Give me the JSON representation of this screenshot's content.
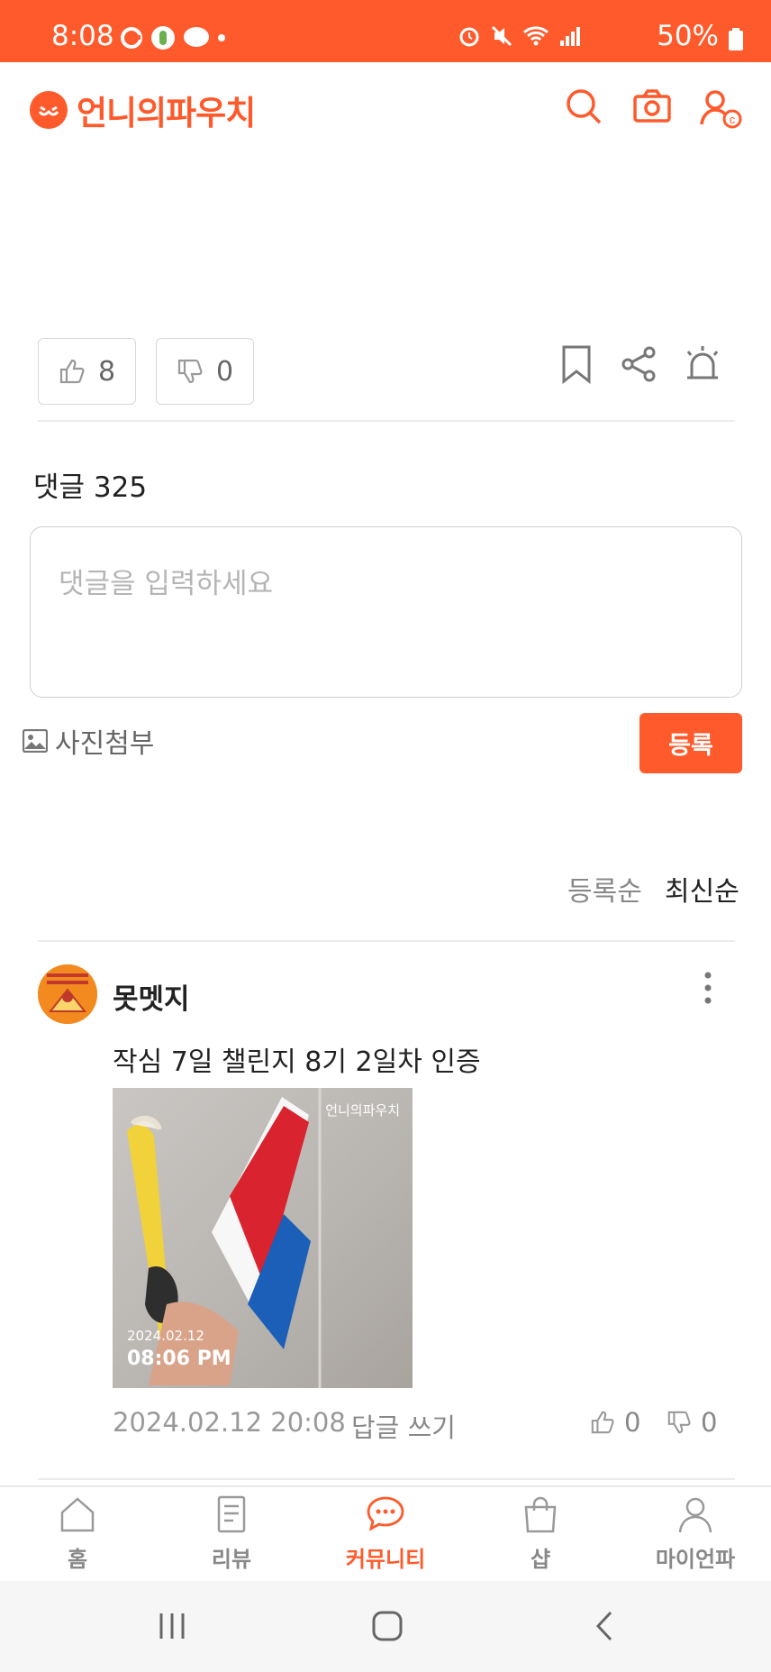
{
  "status_bar": {
    "time": "8:08",
    "battery": "50%"
  },
  "app": {
    "logo_text": "언니의파우치",
    "brand_color": "#fe5a2b"
  },
  "header_icons": [
    "search-icon",
    "camera-icon",
    "user-icon"
  ],
  "reactions": {
    "likes": "8",
    "dislikes": "0"
  },
  "comments": {
    "title": "댓글 325",
    "placeholder": "댓글을 입력하세요",
    "attach_label": "사진첨부",
    "submit_label": "등록",
    "sort_registered": "등록순",
    "sort_latest": "최신순"
  },
  "comment": {
    "author": "못멧지",
    "text": "작심 7일 챌린지 8기 2일차 인증",
    "photo_watermark": "언니의파우치",
    "photo_date": "2024.02.12",
    "photo_time": "08:06 PM",
    "date": "2024.02.12 20:08",
    "reply_label": "답글 쓰기",
    "likes": "0",
    "dislikes": "0"
  },
  "bottom_nav": [
    {
      "label": "홈",
      "icon": "home-icon"
    },
    {
      "label": "리뷰",
      "icon": "review-icon"
    },
    {
      "label": "커뮤니티",
      "icon": "community-icon"
    },
    {
      "label": "샵",
      "icon": "shop-icon"
    },
    {
      "label": "마이언파",
      "icon": "profile-icon"
    }
  ]
}
